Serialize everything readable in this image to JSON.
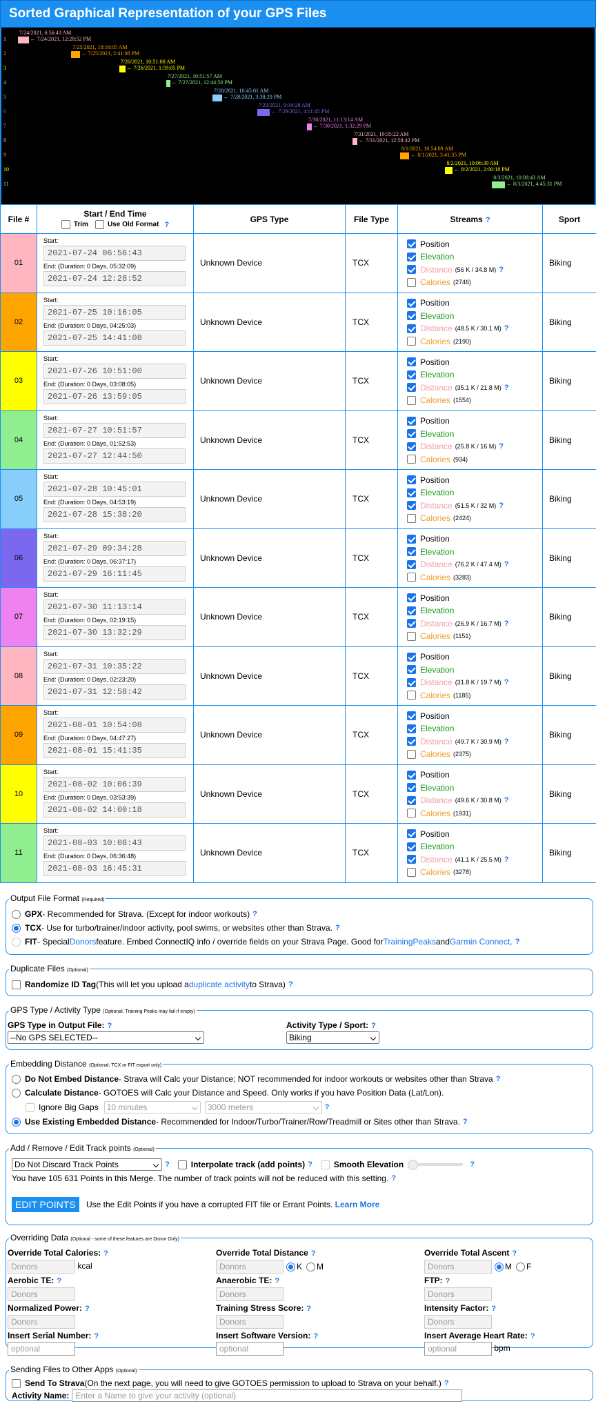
{
  "page": {
    "title": "Sorted Graphical Representation of your GPS Files"
  },
  "timeline": [
    {
      "num": "1",
      "start": "7/24/2021, 6:56:43 AM",
      "end": "← 7/24/2021, 12:28:52 PM",
      "color": "#ffb6c1",
      "text": "#ffb6c1"
    },
    {
      "num": "2",
      "start": "7/25/2021, 10:16:05 AM",
      "end": "← 7/25/2021, 2:41:08 PM",
      "color": "#ffa500",
      "text": "#ffa500"
    },
    {
      "num": "3",
      "start": "7/26/2021, 10:51:00 AM",
      "end": "← 7/26/2021, 1:59:05 PM",
      "color": "#ffff00",
      "text": "#ffff00"
    },
    {
      "num": "4",
      "start": "7/27/2021, 10:51:57 AM",
      "end": "← 7/27/2021, 12:44:50 PM",
      "color": "#90ee90",
      "text": "#90ee90"
    },
    {
      "num": "5",
      "start": "7/28/2021, 10:45:01 AM",
      "end": "← 7/28/2021, 3:38:20 PM",
      "color": "#87cefa",
      "text": "#87cefa"
    },
    {
      "num": "6",
      "start": "7/29/2021, 9:34:28 AM",
      "end": "← 7/29/2021, 4:11:45 PM",
      "color": "#7b68ee",
      "text": "#7b68ee"
    },
    {
      "num": "7",
      "start": "7/30/2021, 11:13:14 AM",
      "end": "← 7/30/2021, 1:32:29 PM",
      "color": "#ee82ee",
      "text": "#ee82ee"
    },
    {
      "num": "8",
      "start": "7/31/2021, 10:35:22 AM",
      "end": "← 7/31/2021, 12:58:42 PM",
      "color": "#ffb6c1",
      "text": "#ffb6c1"
    },
    {
      "num": "9",
      "start": "8/1/2021, 10:54:08 AM",
      "end": "← 8/1/2021, 3:41:35 PM",
      "color": "#ffa500",
      "text": "#ffa500"
    },
    {
      "num": "10",
      "start": "8/2/2021, 10:06:39 AM",
      "end": "← 8/2/2021, 2:00:18 PM",
      "color": "#ffff00",
      "text": "#ffff00"
    },
    {
      "num": "11",
      "start": "8/3/2021, 10:08:43 AM",
      "end": "← 8/3/2021, 4:45:31 PM",
      "color": "#90ee90",
      "text": "#90ee90"
    }
  ],
  "table": {
    "headers": {
      "file": "File #",
      "time": "Start / End Time",
      "trim": "Trim",
      "oldformat": "Use Old Format",
      "gps": "GPS Type",
      "filetype": "File Type",
      "streams": "Streams",
      "sport": "Sport"
    },
    "labels": {
      "start": "Start:",
      "end_prefix": "End:",
      "position": "Position",
      "elevation": "Elevation",
      "distance": "Distance",
      "calories": "Calories"
    },
    "rows": [
      {
        "num": "01",
        "color": "#ffb6c1",
        "start": "2021-07-24 06:56:43",
        "duration": "(Duration: 0 Days, 05:32:09)",
        "end": "2021-07-24 12:28:52",
        "device": "Unknown Device",
        "type": "TCX",
        "dist": "(56 K / 34.8 M)",
        "cal": "(2746)",
        "sport": "Biking"
      },
      {
        "num": "02",
        "color": "#ffa500",
        "start": "2021-07-25 10:16:05",
        "duration": "(Duration: 0 Days, 04:25:03)",
        "end": "2021-07-25 14:41:08",
        "device": "Unknown Device",
        "type": "TCX",
        "dist": "(48.5 K / 30.1 M)",
        "cal": "(2190)",
        "sport": "Biking"
      },
      {
        "num": "03",
        "color": "#ffff00",
        "start": "2021-07-26 10:51:00",
        "duration": "(Duration: 0 Days, 03:08:05)",
        "end": "2021-07-26 13:59:05",
        "device": "Unknown Device",
        "type": "TCX",
        "dist": "(35.1 K / 21.8 M)",
        "cal": "(1554)",
        "sport": "Biking"
      },
      {
        "num": "04",
        "color": "#90ee90",
        "start": "2021-07-27 10:51:57",
        "duration": "(Duration: 0 Days, 01:52:53)",
        "end": "2021-07-27 12:44:50",
        "device": "Unknown Device",
        "type": "TCX",
        "dist": "(25.8 K / 16 M)",
        "cal": "(934)",
        "sport": "Biking"
      },
      {
        "num": "05",
        "color": "#87cefa",
        "start": "2021-07-28 10:45:01",
        "duration": "(Duration: 0 Days, 04:53:19)",
        "end": "2021-07-28 15:38:20",
        "device": "Unknown Device",
        "type": "TCX",
        "dist": "(51.5 K / 32 M)",
        "cal": "(2424)",
        "sport": "Biking"
      },
      {
        "num": "06",
        "color": "#7b68ee",
        "start": "2021-07-29 09:34:28",
        "duration": "(Duration: 0 Days, 06:37:17)",
        "end": "2021-07-29 16:11:45",
        "device": "Unknown Device",
        "type": "TCX",
        "dist": "(76.2 K / 47.4 M)",
        "cal": "(3283)",
        "sport": "Biking"
      },
      {
        "num": "07",
        "color": "#ee82ee",
        "start": "2021-07-30 11:13:14",
        "duration": "(Duration: 0 Days, 02:19:15)",
        "end": "2021-07-30 13:32:29",
        "device": "Unknown Device",
        "type": "TCX",
        "dist": "(26.9 K / 16.7 M)",
        "cal": "(1151)",
        "sport": "Biking"
      },
      {
        "num": "08",
        "color": "#ffb6c1",
        "start": "2021-07-31 10:35:22",
        "duration": "(Duration: 0 Days, 02:23:20)",
        "end": "2021-07-31 12:58:42",
        "device": "Unknown Device",
        "type": "TCX",
        "dist": "(31.8 K / 19.7 M)",
        "cal": "(1185)",
        "sport": "Biking"
      },
      {
        "num": "09",
        "color": "#ffa500",
        "start": "2021-08-01 10:54:08",
        "duration": "(Duration: 0 Days, 04:47:27)",
        "end": "2021-08-01 15:41:35",
        "device": "Unknown Device",
        "type": "TCX",
        "dist": "(49.7 K / 30.9 M)",
        "cal": "(2375)",
        "sport": "Biking"
      },
      {
        "num": "10",
        "color": "#ffff00",
        "start": "2021-08-02 10:06:39",
        "duration": "(Duration: 0 Days, 03:53:39)",
        "end": "2021-08-02 14:00:18",
        "device": "Unknown Device",
        "type": "TCX",
        "dist": "(49.6 K / 30.8 M)",
        "cal": "(1931)",
        "sport": "Biking"
      },
      {
        "num": "11",
        "color": "#90ee90",
        "start": "2021-08-03 10:08:43",
        "duration": "(Duration: 0 Days, 06:36:48)",
        "end": "2021-08-03 16:45:31",
        "device": "Unknown Device",
        "type": "TCX",
        "dist": "(41.1 K / 25.5 M)",
        "cal": "(3278)",
        "sport": "Biking"
      }
    ]
  },
  "output": {
    "legend": "Output File Format",
    "req": "(Required)",
    "gpx_b": "GPX",
    "gpx_t": " - Recommended for Strava. (Except for indoor workouts)",
    "tcx_b": "TCX",
    "tcx_t": " - Use for turbo/trainer/indoor activity, pool swims, or websites other than Strava.",
    "fit_b": "FIT",
    "fit_t1": " - Special ",
    "fit_donors": "Donors",
    "fit_t2": " feature. Embed ConnectIQ info / override fields on your Strava Page. Good for ",
    "fit_tp": "TrainingPeaks",
    "fit_and": " and ",
    "fit_gc": "Garmin Connect",
    "fit_dot": "."
  },
  "dup": {
    "legend": "Duplicate Files",
    "opt": "(Optional)",
    "label": "Randomize ID Tag",
    "t1": " (This will let you upload a ",
    "link": "duplicate activity",
    "t2": " to Strava)"
  },
  "gpstype": {
    "legend": "GPS Type / Activity Type",
    "opt": "(Optional. Training Peaks may fail if empty)",
    "gps_label": "GPS Type in Output File:",
    "gps_value": "--No GPS SELECTED--",
    "act_label": "Activity Type / Sport:",
    "act_value": "Biking"
  },
  "embed": {
    "legend": "Embedding Distance",
    "opt": "(Optional; TCX or FIT export only)",
    "o1_b": "Do Not Embed Distance",
    "o1_t": " - Strava will Calc your Distance; NOT recommended for indoor workouts or websites other than Strava",
    "o2_b": "Calculate Distance",
    "o2_t": " - GOTOES will Calc your Distance and Speed. Only works if you have Position Data (Lat/Lon).",
    "gaps": "Ignore Big Gaps",
    "gap_min": "10 minutes",
    "gap_m": "3000 meters",
    "o3_b": "Use Existing Embedded Distance",
    "o3_t": " - Recommended for Indoor/Turbo/Trainer/Row/Treadmill or Sites other than Strava."
  },
  "track": {
    "legend": "Add / Remove / Edit Track points",
    "opt": "(Optional)",
    "discard": "Do Not Discard Track Points",
    "interp": "Interpolate track (add points)",
    "smooth": "Smooth Elevation",
    "info": "You have 105 631 Points in this Merge. The number of track points will not be reduced with this setting.",
    "edit_btn": "EDIT POINTS",
    "edit_t": "Use the Edit Points if you have a corrupted FIT file or Errant Points.",
    "learn": "Learn More"
  },
  "override": {
    "legend": "Overriding Data",
    "opt": "(Optional - some of these features are Donor Only)",
    "cal": "Override Total Calories:",
    "kcal": "kcal",
    "dist": "Override Total Distance",
    "k": "K",
    "m": "M",
    "ascent": "Override Total Ascent",
    "am": "M",
    "af": "F",
    "aer": "Aerobic TE:",
    "ana": "Anaerobic TE:",
    "ftp": "FTP:",
    "np": "Normalized Power:",
    "tss": "Training Stress Score:",
    "if": "Intensity Factor:",
    "serial": "Insert Serial Number:",
    "software": "Insert Software Version:",
    "hr": "Insert Average Heart Rate:",
    "bpm": "bpm",
    "donors": "Donors",
    "optional": "optional"
  },
  "send": {
    "legend": "Sending Files to Other Apps",
    "opt": "(Optional)",
    "label": "Send To Strava",
    "t": " (On the next page, you will need to give GOTOES permission to upload to Strava on your behalf.)",
    "name_label": "Activity Name:",
    "name_ph": "Enter a Name to give your activity (optional)"
  },
  "help": "?"
}
